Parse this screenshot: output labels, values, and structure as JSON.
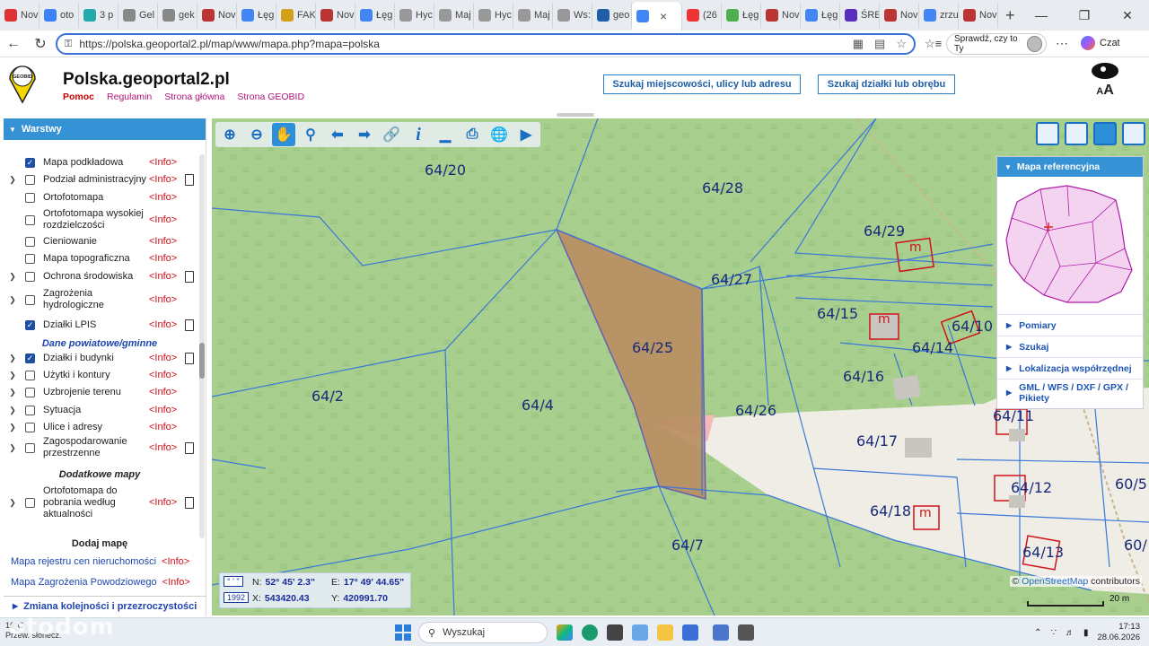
{
  "browser": {
    "tabs": [
      {
        "label": "Nov",
        "color": "#d33"
      },
      {
        "label": "oto",
        "color": "#3b82f6"
      },
      {
        "label": "3 p",
        "color": "#2aa"
      },
      {
        "label": "Gel",
        "color": "#888"
      },
      {
        "label": "gek",
        "color": "#888"
      },
      {
        "label": "Nov",
        "color": "#b33"
      },
      {
        "label": "Łęg",
        "color": "#4285f4"
      },
      {
        "label": "FAK",
        "color": "#d4a017"
      },
      {
        "label": "Nov",
        "color": "#b33"
      },
      {
        "label": "Łęg",
        "color": "#4285f4"
      },
      {
        "label": "Hyc",
        "color": "#999"
      },
      {
        "label": "Maj",
        "color": "#999"
      },
      {
        "label": "Hyc",
        "color": "#999"
      },
      {
        "label": "Maj",
        "color": "#999"
      },
      {
        "label": "Ws:",
        "color": "#999"
      },
      {
        "label": "geo",
        "color": "#1e5fa7"
      },
      {
        "label": "",
        "color": "#4285f4",
        "active": true
      },
      {
        "label": "(26",
        "color": "#e33"
      },
      {
        "label": "Łęg",
        "color": "#4caf50"
      },
      {
        "label": "Nov",
        "color": "#b33"
      },
      {
        "label": "Łęg",
        "color": "#4285f4"
      },
      {
        "label": "ŚRE",
        "color": "#5b2dbf"
      },
      {
        "label": "Nov",
        "color": "#b33"
      },
      {
        "label": "zrzu",
        "color": "#4285f4"
      },
      {
        "label": "Nov",
        "color": "#b33"
      }
    ],
    "url": "https://polska.geoportal2.pl/map/www/mapa.php?mapa=polska",
    "profile_label": "Sprawdź, czy to Ty",
    "copilot_label": "Czat"
  },
  "site": {
    "title": "Polska.geoportal2.pl",
    "logo_text": "GEOBID",
    "links": {
      "help": "Pomoc",
      "rules": "Regulamin",
      "home": "Strona główna",
      "geobid": "Strona GEOBID"
    },
    "search_address": "Szukaj miejscowości, ulicy lub adresu",
    "search_plot": "Szukaj działki lub obrębu",
    "font_size_label": "A",
    "font_size_label_big": "A"
  },
  "layers_panel": {
    "title": "Warstwy",
    "info_label": "<Info>",
    "layers": [
      {
        "name": "Mapa podkładowa",
        "checked": true,
        "expandable": false,
        "doc": false
      },
      {
        "name": "Podział administracyjny",
        "checked": false,
        "expandable": true,
        "doc": true
      },
      {
        "name": "Ortofotomapa",
        "checked": false,
        "expandable": false,
        "doc": false
      },
      {
        "name": "Ortofotomapa wysokiej rozdzielczości",
        "checked": false,
        "expandable": false,
        "doc": false
      },
      {
        "name": "Cieniowanie",
        "checked": false,
        "expandable": false,
        "doc": false
      },
      {
        "name": "Mapa topograficzna",
        "checked": false,
        "expandable": false,
        "doc": false
      },
      {
        "name": "Ochrona środowiska",
        "checked": false,
        "expandable": true,
        "doc": true
      },
      {
        "name": "Zagrożenia hydrologiczne",
        "checked": false,
        "expandable": true,
        "doc": false
      },
      {
        "name": "Działki LPIS",
        "checked": true,
        "expandable": false,
        "doc": true
      }
    ],
    "section_powiat": "Dane powiatowe/gminne",
    "layers2": [
      {
        "name": "Działki i budynki",
        "checked": true,
        "expandable": true,
        "doc": true
      },
      {
        "name": "Użytki i kontury",
        "checked": false,
        "expandable": true,
        "doc": false
      },
      {
        "name": "Uzbrojenie terenu",
        "checked": false,
        "expandable": true,
        "doc": false
      },
      {
        "name": "Sytuacja",
        "checked": false,
        "expandable": true,
        "doc": false
      },
      {
        "name": "Ulice i adresy",
        "checked": false,
        "expandable": true,
        "doc": false
      },
      {
        "name": "Zagospodarowanie przestrzenne",
        "checked": false,
        "expandable": true,
        "doc": true
      }
    ],
    "section_extra": "Dodatkowe mapy",
    "layers3": [
      {
        "name": "Ortofotomapa do pobrania według aktualności",
        "checked": false,
        "expandable": true,
        "doc": true
      }
    ],
    "add_map": "Dodaj mapę",
    "extra_maps": [
      "Mapa rejestru cen nieruchomości",
      "Mapa Zagrożenia Powodziowego"
    ],
    "footer": "Zmiana kolejności i przezroczystości"
  },
  "map": {
    "plots": [
      "64/20",
      "64/28",
      "64/29",
      "64/27",
      "64/15",
      "64/10",
      "64/14",
      "64/25",
      "64/2",
      "64/4",
      "64/16",
      "64/26",
      "64/11",
      "64/17",
      "64/12",
      "60/5",
      "64/18",
      "64/7",
      "64/13",
      "60/"
    ],
    "building_mark": "m",
    "colors": {
      "forest": "#a8cf8e",
      "selected": "#b98e62",
      "urban": "#f0ede6",
      "plot_line": "#3a77d8",
      "building": "#d0131a"
    },
    "ref_panel": {
      "title": "Mapa referencyjna",
      "items": [
        "Pomiary",
        "Szukaj",
        "Lokalizacja współrzędnej",
        "GML / WFS / DXF / GPX / Pikiety"
      ]
    },
    "coords": {
      "unit_box": "° ' \"",
      "system_box": "1992",
      "n_label": "N:",
      "n_value": "52° 45' 2.3\"",
      "e_label": "E:",
      "e_value": "17° 49' 44.65\"",
      "x_label": "X:",
      "x_value": "543420.43",
      "y_label": "Y:",
      "y_value": "420991.70"
    },
    "attribution_prefix": "©",
    "attribution_link": "OpenStreetMap",
    "attribution_suffix": "contributors",
    "scale": "20 m"
  },
  "taskbar": {
    "weather_line1": "16°C",
    "weather_line2": "Przew. słonecz.",
    "search": "Wyszukaj",
    "time": "17:13",
    "date": "28.06.2026",
    "watermark": "otodom"
  }
}
